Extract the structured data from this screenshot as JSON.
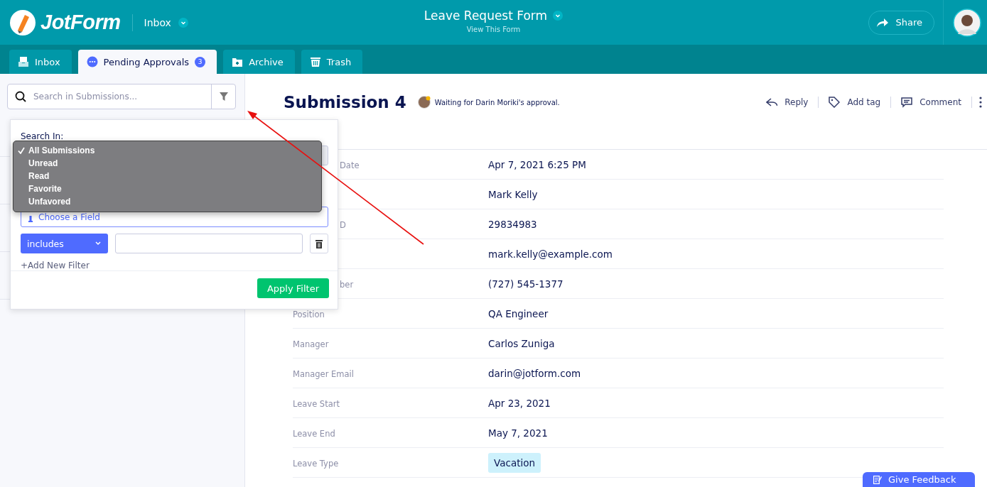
{
  "header": {
    "logo": "JotForm",
    "section": "Inbox",
    "form_title": "Leave Request Form",
    "form_link": "View This Form",
    "share": "Share"
  },
  "tabs": [
    {
      "label": "Inbox",
      "kind": "inbox",
      "selected": false
    },
    {
      "label": "Pending Approvals",
      "kind": "pending",
      "selected": true,
      "badge": "3"
    },
    {
      "label": "Archive",
      "kind": "archive",
      "selected": false
    },
    {
      "label": "Trash",
      "kind": "trash",
      "selected": false
    }
  ],
  "sidebar": {
    "search": {
      "placeholder": "Search in Submissions..."
    }
  },
  "filter_popup": {
    "search_in_label": "Search In:",
    "search_in_options": [
      {
        "label": "All Submissions",
        "selected": true
      },
      {
        "label": "Unread",
        "selected": false
      },
      {
        "label": "Read",
        "selected": false
      },
      {
        "label": "Favorite",
        "selected": false
      },
      {
        "label": "Unfavored",
        "selected": false
      }
    ],
    "field": {
      "placeholder": "Choose a Field"
    },
    "operator": "includes",
    "add_filter": "+Add New Filter",
    "apply": "Apply Filter"
  },
  "submission": {
    "title": "Submission 4",
    "status": "Waiting for Darin Moriki's approval.",
    "actions": [
      {
        "label": "Reply",
        "kind": "reply"
      },
      {
        "label": "Add tag",
        "kind": "tag"
      },
      {
        "label": "Comment",
        "kind": "comment"
      }
    ],
    "rows": [
      {
        "label": "Date",
        "value": "Apr 7, 2021 6:25 PM",
        "kind": "text",
        "hidden_label": true
      },
      {
        "value": "Mark Kelly",
        "kind": "text"
      },
      {
        "label": "D",
        "value": "29834983",
        "kind": "text",
        "hidden_label": true
      },
      {
        "value": "mark.kelly@example.com",
        "kind": "text"
      },
      {
        "label": "ber",
        "value": "(727) 545-1377",
        "kind": "text",
        "hidden_label": true
      },
      {
        "label": "Position",
        "value": "QA Engineer",
        "kind": "text"
      },
      {
        "label": "Manager",
        "value": "Carlos Zuniga",
        "kind": "text"
      },
      {
        "label": "Manager Email",
        "value": "darin@jotform.com",
        "kind": "text"
      },
      {
        "label": "Leave Start",
        "value": "Apr 23, 2021",
        "kind": "text"
      },
      {
        "label": "Leave End",
        "value": "May 7, 2021",
        "kind": "text"
      },
      {
        "label": "Leave Type",
        "value": "Vacation",
        "kind": "tag"
      }
    ]
  },
  "feedback_button": "Give Feedback"
}
